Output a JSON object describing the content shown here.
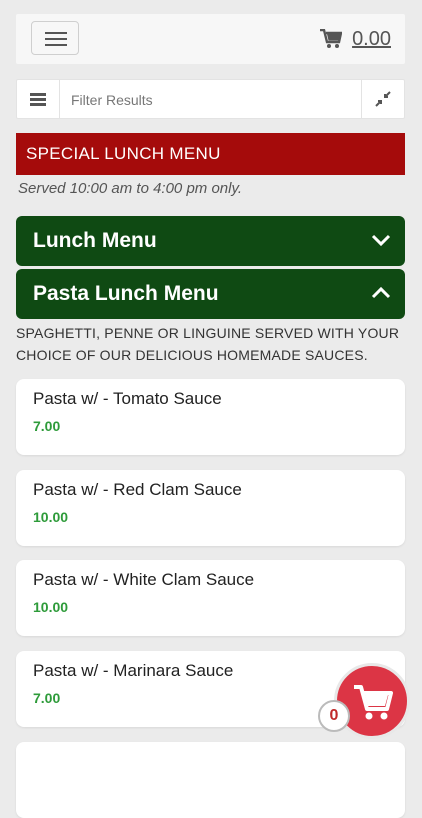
{
  "header": {
    "cart_total": "0.00"
  },
  "filter": {
    "placeholder": "Filter Results"
  },
  "banner": {
    "title": "SPECIAL LUNCH MENU",
    "served": "Served 10:00 am to 4:00 pm only."
  },
  "categories": [
    {
      "label": "Lunch Menu",
      "state": "collapsed"
    },
    {
      "label": "Pasta Lunch Menu",
      "state": "expanded"
    }
  ],
  "pasta_description": "SPAGHETTI, PENNE OR LINGUINE SERVED WITH YOUR CHOICE OF OUR DELICIOUS HOMEMADE SAUCES.",
  "items": [
    {
      "name": "Pasta w/ - Tomato Sauce",
      "price": "7.00"
    },
    {
      "name": "Pasta w/ - Red Clam Sauce",
      "price": "10.00"
    },
    {
      "name": "Pasta w/ - White Clam Sauce",
      "price": "10.00"
    },
    {
      "name": "Pasta w/ - Marinara Sauce",
      "price": "7.00"
    }
  ],
  "cart_fab": {
    "count": "0"
  },
  "colors": {
    "banner": "#a50b0b",
    "category": "#0f4a13",
    "price": "#2e9b3a",
    "fab": "#dc3545"
  }
}
